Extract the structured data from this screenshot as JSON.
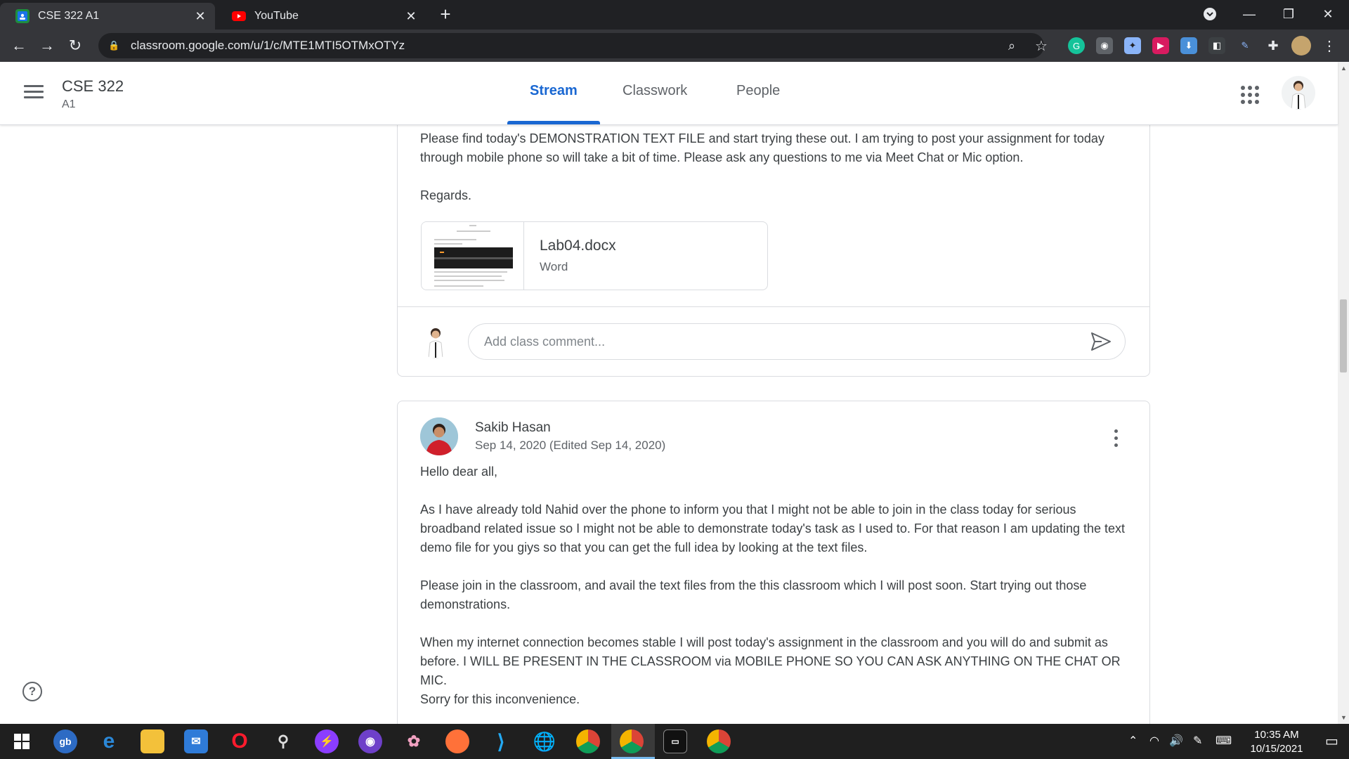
{
  "browser": {
    "tabs": [
      {
        "title": "CSE 322 A1",
        "favicon": "google-classroom-icon",
        "active": true
      },
      {
        "title": "YouTube",
        "favicon": "youtube-icon",
        "active": false
      }
    ],
    "url": "classroom.google.com/u/1/c/MTE1MTI5OTMxOTYz"
  },
  "header": {
    "class_name": "CSE 322",
    "section": "A1",
    "tabs": [
      "Stream",
      "Classwork",
      "People"
    ],
    "active_tab": "Stream"
  },
  "post1": {
    "body": [
      "Please find today's DEMONSTRATION TEXT FILE and start trying these out. I am trying to post your assignment for today through mobile phone so will take a bit of time. Please ask any questions to me via Meet Chat or Mic option.",
      "Regards."
    ],
    "attachment": {
      "name": "Lab04.docx",
      "type": "Word"
    },
    "comment_placeholder": "Add class comment..."
  },
  "post2": {
    "author": "Sakib Hasan",
    "date": "Sep 14, 2020 (Edited Sep 14, 2020)",
    "body": [
      "Hello dear all,",
      "As I have already told Nahid over the phone to inform you that I might not be able to join in the class today for serious broadband related issue so I might not be able to demonstrate today's task as I used to. For that reason I am updating the text demo file for you giys so that you can get the full idea by looking at the text files.",
      "Please join in the classroom, and avail the text files from the this classroom which I will post soon. Start trying out those demonstrations.",
      "When my internet connection becomes stable I will post today's assignment in the classroom and you will do and submit as before. I WILL BE PRESENT IN THE CLASSROOM via MOBILE PHONE SO YOU CAN ASK ANYTHING ON THE CHAT OR MIC.",
      "Sorry for this inconvenience."
    ]
  },
  "help": {
    "label": "?"
  },
  "taskbar": {
    "time": "10:35 AM",
    "date": "10/15/2021"
  },
  "colors": {
    "accent": "#1967d2",
    "chrome_dark": "#202124",
    "text": "#3c4043",
    "muted": "#5f6368"
  }
}
